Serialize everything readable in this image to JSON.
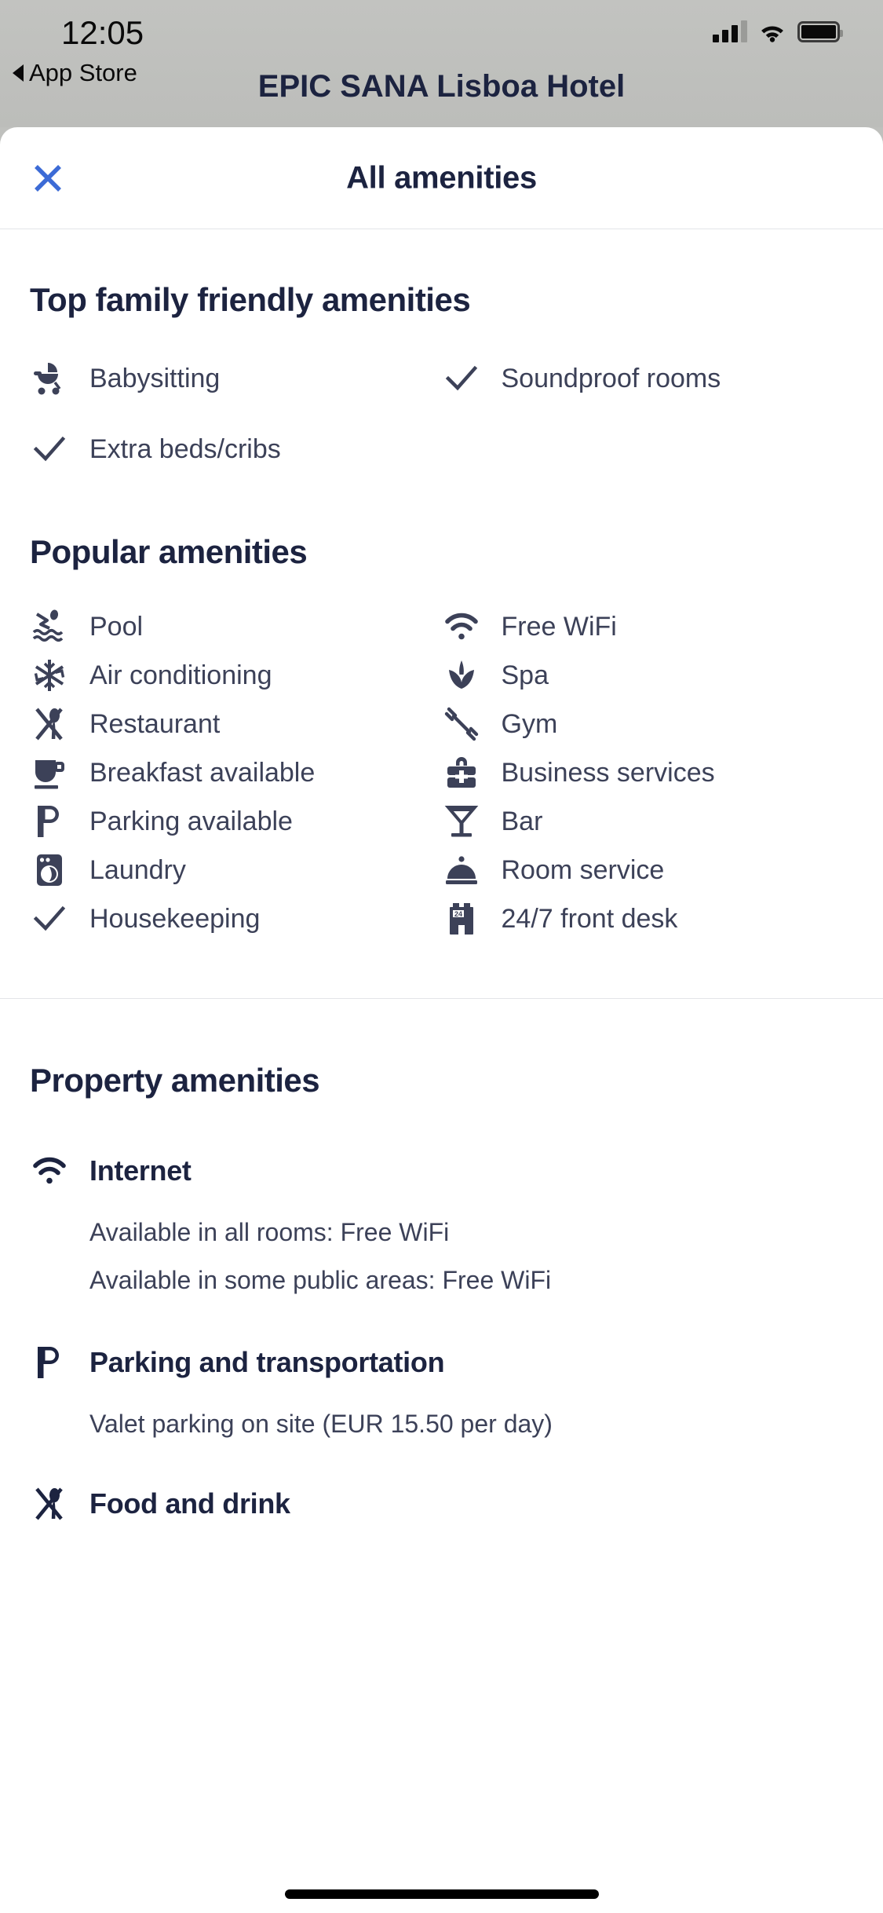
{
  "status_bar": {
    "time": "12:05",
    "back_label": "App Store",
    "signal_icon": "cellular-signal-icon",
    "wifi_icon": "wifi-icon",
    "battery_icon": "battery-icon"
  },
  "background_page": {
    "title": "EPIC SANA Lisboa Hotel"
  },
  "sheet": {
    "title": "All amenities",
    "close_icon": "close-icon",
    "close_color": "#3c6bd6"
  },
  "sections": {
    "family": {
      "title": "Top family friendly amenities",
      "items": [
        {
          "label": "Babysitting",
          "icon": "stroller-icon"
        },
        {
          "label": "Soundproof rooms",
          "icon": "check-icon"
        },
        {
          "label": "Extra beds/cribs",
          "icon": "check-icon"
        }
      ]
    },
    "popular": {
      "title": "Popular amenities",
      "items": [
        {
          "label": "Pool",
          "icon": "pool-icon"
        },
        {
          "label": "Free WiFi",
          "icon": "wifi-icon"
        },
        {
          "label": "Air conditioning",
          "icon": "snowflake-icon"
        },
        {
          "label": "Spa",
          "icon": "spa-icon"
        },
        {
          "label": "Restaurant",
          "icon": "restaurant-icon"
        },
        {
          "label": "Gym",
          "icon": "dumbbell-icon"
        },
        {
          "label": "Breakfast available",
          "icon": "coffee-cup-icon"
        },
        {
          "label": "Business services",
          "icon": "briefcase-icon"
        },
        {
          "label": "Parking available",
          "icon": "parking-icon"
        },
        {
          "label": "Bar",
          "icon": "cocktail-glass-icon"
        },
        {
          "label": "Laundry",
          "icon": "washing-machine-icon"
        },
        {
          "label": "Room service",
          "icon": "cloche-icon"
        },
        {
          "label": "Housekeeping",
          "icon": "check-icon"
        },
        {
          "label": "24/7 front desk",
          "icon": "front-desk-building-icon"
        }
      ]
    },
    "property": {
      "title": "Property amenities",
      "blocks": [
        {
          "title": "Internet",
          "icon": "wifi-icon",
          "lines": [
            "Available in all rooms: Free WiFi",
            "Available in some public areas: Free WiFi"
          ]
        },
        {
          "title": "Parking and transportation",
          "icon": "parking-icon",
          "lines": [
            "Valet parking on site (EUR 15.50 per day)"
          ]
        },
        {
          "title": "Food and drink",
          "icon": "restaurant-icon",
          "lines": []
        }
      ]
    }
  },
  "colors": {
    "text_primary": "#1c2340",
    "text_body": "#3c4158",
    "accent_blue": "#3c6bd6",
    "divider": "#e3e5e8"
  }
}
